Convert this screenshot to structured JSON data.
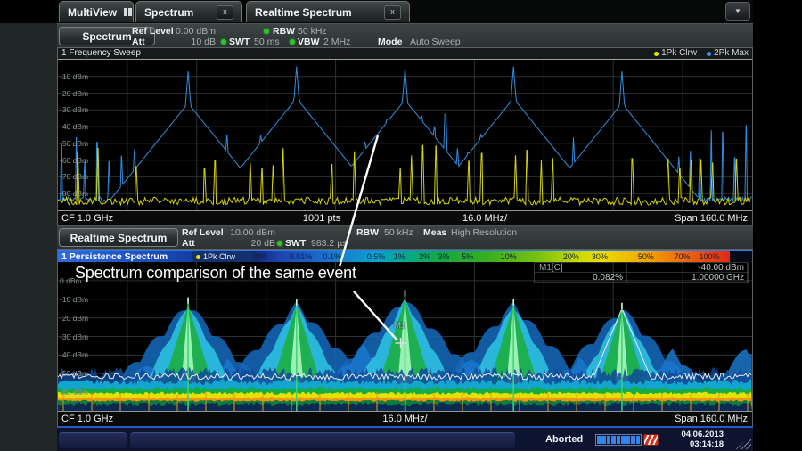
{
  "tabs": {
    "multiview": "MultiView",
    "spectrum": "Spectrum",
    "realtime": "Realtime Spectrum"
  },
  "spectrum_channel": {
    "name": "Spectrum",
    "ref_level_label": "Ref Level",
    "ref_level": "0.00 dBm",
    "att_label": "Att",
    "att": "10 dB",
    "swt_label": "SWT",
    "swt": "50 ms",
    "rbw_label": "RBW",
    "rbw": "50 kHz",
    "vbw_label": "VBW",
    "vbw": "2 MHz",
    "mode_label": "Mode",
    "mode": "Auto Sweep"
  },
  "sweep_panel": {
    "title": "1 Frequency Sweep",
    "legend": [
      {
        "label": "1Pk Clrw",
        "color": "#d6d400"
      },
      {
        "label": "2Pk Max",
        "color": "#2f8fdf"
      }
    ],
    "y_labels": [
      "-10 dBm",
      "-20 dBm",
      "-30 dBm",
      "-40 dBm",
      "-50 dBm",
      "-60 dBm",
      "-70 dBm",
      "-80 dBm"
    ],
    "axis": {
      "cf": "CF 1.0 GHz",
      "pts": "1001 pts",
      "per_div": "16.0 MHz/",
      "span": "Span 160.0 MHz"
    }
  },
  "realtime_channel": {
    "name": "Realtime Spectrum",
    "ref_level_label": "Ref Level",
    "ref_level": "10.00 dBm",
    "att_label": "Att",
    "att": "20 dB",
    "swt_label": "SWT",
    "swt": "983.2 µs",
    "rbw_label": "RBW",
    "rbw": "50 kHz",
    "meas_label": "Meas",
    "meas": "High Resolution"
  },
  "persistence_panel": {
    "title": "1 Persistence Spectrum",
    "trace_label": "1Pk Clrw",
    "scale_labels": [
      "0%",
      "0.01%",
      "0.1%",
      "0.5%",
      "1%",
      "2%",
      "3%",
      "5%",
      "10%",
      "20%",
      "30%",
      "50%",
      "70%",
      "100%"
    ],
    "y_labels": [
      "0 dBm",
      "-10 dBm",
      "-20 dBm",
      "-30 dBm",
      "-40 dBm",
      "-50 dBm",
      "-60 dBm"
    ],
    "marker": {
      "name": "M1[C]",
      "short": "M1",
      "level": "-40.00 dBm",
      "percent": "0.082%",
      "freq": "1.00000 GHz"
    },
    "axis": {
      "cf": "CF 1.0 GHz",
      "per_div": "16.0 MHz/",
      "span": "Span 160.0 MHz"
    }
  },
  "annotation": {
    "text": "Spectrum comparison of the same event"
  },
  "status_bar": {
    "state": "Aborted",
    "date": "04.06.2013",
    "time": "03:14:18"
  },
  "chart_data": [
    {
      "type": "line",
      "panel": "1 Frequency Sweep",
      "x_axis": {
        "center_ghz": 1.0,
        "span_mhz": 160.0,
        "mhz_per_div": 16.0,
        "points": 1001
      },
      "y_axis": {
        "ref_level_dbm": 0.0,
        "db_per_div": 10.0,
        "min_dbm": -90.0
      },
      "series": [
        {
          "name": "1Pk Clrw",
          "color": "#d6d400",
          "detector": "clear/write peak",
          "noise_floor_dbm": -84.5,
          "impulse_spike_levels_dbm": [
            -66,
            -50
          ]
        },
        {
          "name": "2Pk Max",
          "color": "#2f8fdf",
          "detector": "max hold peak",
          "noise_floor_dbm": -83.5,
          "main_peaks": [
            {
              "freq_mhz": 950.0,
              "level_dbm": -7
            },
            {
              "freq_mhz": 975.0,
              "level_dbm": -4
            },
            {
              "freq_mhz": 1000.0,
              "level_dbm": -5
            },
            {
              "freq_mhz": 1025.0,
              "level_dbm": -4
            },
            {
              "freq_mhz": 1050.0,
              "level_dbm": -7
            }
          ],
          "comb_spike_levels_dbm": [
            -80,
            -33
          ]
        }
      ]
    },
    {
      "type": "persistence",
      "panel": "1 Persistence Spectrum",
      "x_axis": {
        "center_ghz": 1.0,
        "span_mhz": 160.0,
        "mhz_per_div": 16.0
      },
      "y_axis": {
        "ref_level_dbm": 10.0,
        "db_per_div": 10.0,
        "min_dbm": -70.0
      },
      "main_peaks": [
        {
          "freq_mhz": 950.0,
          "needle_dbm": -9,
          "body_dbm": -13
        },
        {
          "freq_mhz": 975.0,
          "needle_dbm": -10,
          "body_dbm": -13
        },
        {
          "freq_mhz": 1000.0,
          "needle_dbm": -5,
          "body_dbm": -10
        },
        {
          "freq_mhz": 1025.0,
          "needle_dbm": -10,
          "body_dbm": -13
        },
        {
          "freq_mhz": 1050.0,
          "needle_dbm": -12,
          "body_dbm": -15
        }
      ],
      "side_clusters": [
        {
          "freq_mhz": 940.5,
          "level_dbm": -46
        },
        {
          "freq_mhz": 959.0,
          "level_dbm": -45
        },
        {
          "freq_mhz": 990.4,
          "level_dbm": -37
        },
        {
          "freq_mhz": 1015.5,
          "level_dbm": -43
        },
        {
          "freq_mhz": 1040.1,
          "level_dbm": -44
        },
        {
          "freq_mhz": 1061.7,
          "level_dbm": -40
        },
        {
          "freq_mhz": 1078.7,
          "level_dbm": -38
        }
      ],
      "noise_floor_dbm": -52,
      "density_color_scale_pct": [
        0,
        0.01,
        0.1,
        0.5,
        1,
        2,
        3,
        5,
        10,
        20,
        30,
        50,
        70,
        100
      ],
      "marker": {
        "name": "M1",
        "freq_ghz": 1.0,
        "level_dbm": -40.0,
        "density_pct": 0.082
      }
    }
  ]
}
